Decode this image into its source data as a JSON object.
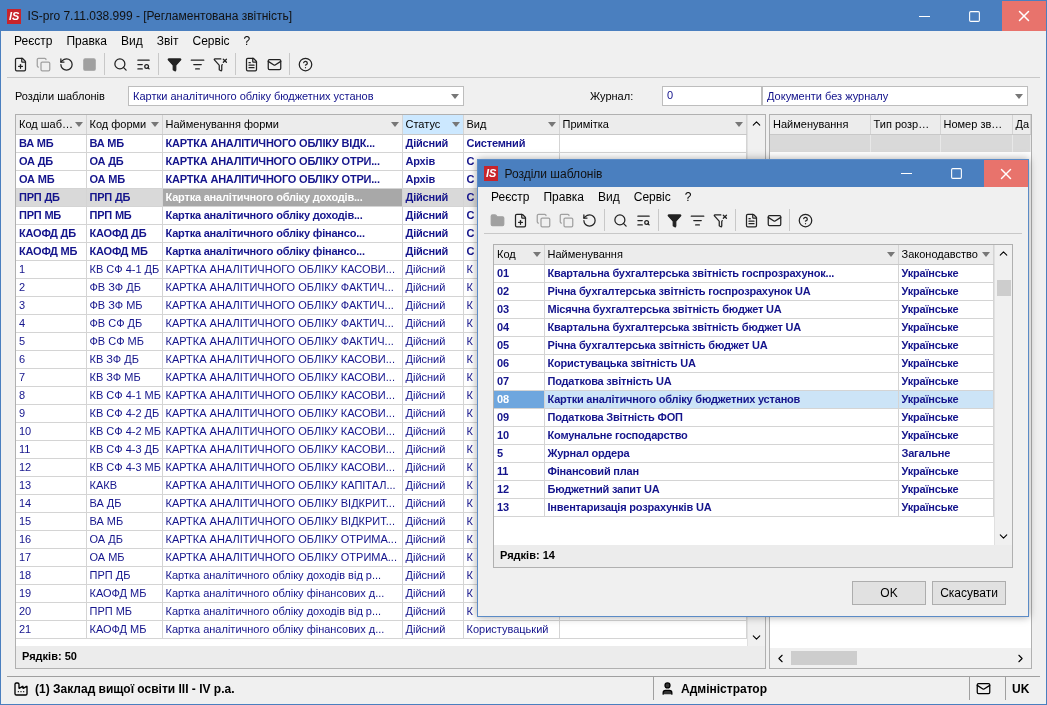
{
  "window": {
    "title": "IS-pro 7.11.038.999 - [Регламентована звітність]",
    "logo": "IS",
    "menu": [
      "Реєстр",
      "Правка",
      "Вид",
      "Звіт",
      "Сервіс",
      "?"
    ],
    "toolbar": [
      {
        "kind": "new",
        "disabled": false
      },
      {
        "kind": "copy",
        "disabled": true
      },
      {
        "kind": "refresh",
        "disabled": false
      },
      {
        "kind": "stop",
        "disabled": true
      },
      {
        "kind": "separator"
      },
      {
        "kind": "search",
        "disabled": false
      },
      {
        "kind": "find_next",
        "disabled": false
      },
      {
        "kind": "separator"
      },
      {
        "kind": "filter",
        "disabled": false
      },
      {
        "kind": "filter_sub",
        "disabled": false
      },
      {
        "kind": "filter_clear",
        "disabled": false
      },
      {
        "kind": "separator"
      },
      {
        "kind": "doc",
        "disabled": false
      },
      {
        "kind": "mail",
        "disabled": false
      },
      {
        "kind": "separator"
      },
      {
        "kind": "help",
        "disabled": false
      }
    ]
  },
  "filters": {
    "sections_label": "Розділи шаблонів",
    "sections_value": "Картки аналітичного обліку бюджетних установ",
    "journal_label": "Журнал:",
    "journal_value": "0",
    "journal_name": "Документи без журналу"
  },
  "forms_table": {
    "columns": [
      {
        "label": "Код шаб…",
        "sorted": false,
        "focused": false
      },
      {
        "label": "Код форми",
        "sorted": false,
        "focused": false
      },
      {
        "label": "Найменування форми",
        "sorted": false,
        "focused": true
      },
      {
        "label": "Статус",
        "sorted": true,
        "focused": false
      },
      {
        "label": "Вид",
        "sorted": false,
        "focused": false
      },
      {
        "label": "Примітка",
        "sorted": false
      }
    ],
    "rows": [
      {
        "cells": [
          "ВА МБ",
          "ВА МБ",
          "КАРТКА АНАЛІТИЧНОГО ОБЛІКУ ВІДК...",
          "Дійсний",
          "Системний",
          ""
        ],
        "bold": true,
        "selected": false
      },
      {
        "cells": [
          "ОА ДБ",
          "ОА ДБ",
          "КАРТКА АНАЛІТИЧНОГО ОБЛІКУ ОТРИ...",
          "Архів",
          "С",
          ""
        ],
        "bold": true,
        "selected": false
      },
      {
        "cells": [
          "ОА МБ",
          "ОА МБ",
          "КАРТКА АНАЛІТИЧНОГО ОБЛІКУ ОТРИ...",
          "Архів",
          "С",
          ""
        ],
        "bold": true,
        "selected": false
      },
      {
        "cells": [
          "ПРП ДБ",
          "ПРП ДБ",
          "Картка аналітичного обліку доходів...",
          "Дійсний",
          "С",
          ""
        ],
        "bold": true,
        "selected": true
      },
      {
        "cells": [
          "ПРП МБ",
          "ПРП МБ",
          "Картка аналітичного обліку доходів...",
          "Дійсний",
          "С",
          ""
        ],
        "bold": true,
        "selected": false
      },
      {
        "cells": [
          "КАОФД ДБ",
          "КАОФД ДБ",
          "Картка аналітичного обліку фінансо...",
          "Дійсний",
          "С",
          ""
        ],
        "bold": true,
        "selected": false
      },
      {
        "cells": [
          "КАОФД МБ",
          "КАОФД МБ",
          "Картка аналітичного обліку фінансо...",
          "Дійсний",
          "С",
          ""
        ],
        "bold": true,
        "selected": false
      },
      {
        "cells": [
          "1",
          "КВ СФ 4-1 ДБ",
          "КАРТКА АНАЛІТИЧНОГО ОБЛІКУ КАСОВИ...",
          "Дійсний",
          "К",
          ""
        ],
        "bold": false,
        "selected": false
      },
      {
        "cells": [
          "2",
          "ФВ ЗФ ДБ",
          "КАРТКА АНАЛІТИЧНОГО ОБЛІКУ ФАКТИЧ...",
          "Дійсний",
          "К",
          ""
        ],
        "bold": false,
        "selected": false
      },
      {
        "cells": [
          "3",
          "ФВ ЗФ МБ",
          "КАРТКА АНАЛІТИЧНОГО ОБЛІКУ ФАКТИЧ...",
          "Дійсний",
          "К",
          ""
        ],
        "bold": false,
        "selected": false
      },
      {
        "cells": [
          "4",
          "ФВ СФ ДБ",
          "КАРТКА АНАЛІТИЧНОГО ОБЛІКУ ФАКТИЧ...",
          "Дійсний",
          "К",
          ""
        ],
        "bold": false,
        "selected": false
      },
      {
        "cells": [
          "5",
          "ФВ СФ МБ",
          "КАРТКА АНАЛІТИЧНОГО ОБЛІКУ ФАКТИЧ...",
          "Дійсний",
          "К",
          ""
        ],
        "bold": false,
        "selected": false
      },
      {
        "cells": [
          "6",
          "КВ ЗФ ДБ",
          "КАРТКА АНАЛІТИЧНОГО ОБЛІКУ КАСОВИ...",
          "Дійсний",
          "К",
          ""
        ],
        "bold": false,
        "selected": false
      },
      {
        "cells": [
          "7",
          "КВ ЗФ МБ",
          "КАРТКА АНАЛІТИЧНОГО ОБЛІКУ КАСОВИ...",
          "Дійсний",
          "К",
          ""
        ],
        "bold": false,
        "selected": false
      },
      {
        "cells": [
          "8",
          "КВ СФ 4-1 МБ",
          "КАРТКА АНАЛІТИЧНОГО ОБЛІКУ КАСОВИ...",
          "Дійсний",
          "К",
          ""
        ],
        "bold": false,
        "selected": false
      },
      {
        "cells": [
          "9",
          "КВ СФ 4-2 ДБ",
          "КАРТКА АНАЛІТИЧНОГО ОБЛІКУ КАСОВИ...",
          "Дійсний",
          "К",
          ""
        ],
        "bold": false,
        "selected": false
      },
      {
        "cells": [
          "10",
          "КВ СФ 4-2 МБ",
          "КАРТКА АНАЛІТИЧНОГО ОБЛІКУ КАСОВИ...",
          "Дійсний",
          "К",
          ""
        ],
        "bold": false,
        "selected": false
      },
      {
        "cells": [
          "11",
          "КВ СФ 4-3 ДБ",
          "КАРТКА АНАЛІТИЧНОГО ОБЛІКУ КАСОВИ...",
          "Дійсний",
          "К",
          ""
        ],
        "bold": false,
        "selected": false
      },
      {
        "cells": [
          "12",
          "КВ СФ 4-3 МБ",
          "КАРТКА АНАЛІТИЧНОГО ОБЛІКУ КАСОВИ...",
          "Дійсний",
          "К",
          ""
        ],
        "bold": false,
        "selected": false
      },
      {
        "cells": [
          "13",
          "КАКВ",
          "КАРТКА АНАЛІТИЧНОГО ОБЛІКУ КАПІТАЛ...",
          "Дійсний",
          "К",
          ""
        ],
        "bold": false,
        "selected": false
      },
      {
        "cells": [
          "14",
          "ВА ДБ",
          "КАРТКА АНАЛІТИЧНОГО ОБЛІКУ ВІДКРИТ...",
          "Дійсний",
          "К",
          ""
        ],
        "bold": false,
        "selected": false
      },
      {
        "cells": [
          "15",
          "ВА МБ",
          "КАРТКА АНАЛІТИЧНОГО ОБЛІКУ ВІДКРИТ...",
          "Дійсний",
          "К",
          ""
        ],
        "bold": false,
        "selected": false
      },
      {
        "cells": [
          "16",
          "ОА ДБ",
          "КАРТКА АНАЛІТИЧНОГО ОБЛІКУ ОТРИМА...",
          "Дійсний",
          "К",
          ""
        ],
        "bold": false,
        "selected": false
      },
      {
        "cells": [
          "17",
          "ОА МБ",
          "КАРТКА АНАЛІТИЧНОГО ОБЛІКУ ОТРИМА...",
          "Дійсний",
          "К",
          ""
        ],
        "bold": false,
        "selected": false
      },
      {
        "cells": [
          "18",
          "ПРП ДБ",
          "Картка аналітичного обліку доходів від р...",
          "Дійсний",
          "К",
          ""
        ],
        "bold": false,
        "selected": false
      },
      {
        "cells": [
          "19",
          "КАОФД МБ",
          "Картка аналітичного обліку фінансових д...",
          "Дійсний",
          "К",
          ""
        ],
        "bold": false,
        "selected": false
      },
      {
        "cells": [
          "20",
          "ПРП МБ",
          "Картка аналітичного обліку доходів від р...",
          "Дійсний",
          "К",
          ""
        ],
        "bold": false,
        "selected": false
      },
      {
        "cells": [
          "21",
          "КАОФД МБ",
          "Картка аналітичного обліку фінансових д...",
          "Дійсний",
          "Користувацький",
          ""
        ],
        "bold": false,
        "selected": false
      }
    ],
    "footer": "Рядків: 50"
  },
  "details_table": {
    "columns": [
      "Найменування",
      "Тип розр…",
      "Номер зв…",
      "Да"
    ]
  },
  "status_bar": {
    "organization": "(1) Заклад вищої освіти III - IV р.а.",
    "user": "Адміністратор",
    "language": "UK"
  },
  "dialog": {
    "title": "Розділи шаблонів",
    "logo": "IS",
    "menu": [
      "Реєстр",
      "Правка",
      "Вид",
      "Сервіс",
      "?"
    ],
    "toolbar": [
      {
        "kind": "folder",
        "disabled": true
      },
      {
        "kind": "new",
        "disabled": false
      },
      {
        "kind": "copy",
        "disabled": true
      },
      {
        "kind": "copy",
        "disabled": true
      },
      {
        "kind": "refresh",
        "disabled": false
      },
      {
        "kind": "separator"
      },
      {
        "kind": "search",
        "disabled": false
      },
      {
        "kind": "find_next",
        "disabled": false
      },
      {
        "kind": "separator"
      },
      {
        "kind": "filter",
        "disabled": false
      },
      {
        "kind": "filter_sub",
        "disabled": false
      },
      {
        "kind": "filter_clear",
        "disabled": false
      },
      {
        "kind": "separator"
      },
      {
        "kind": "doc",
        "disabled": false
      },
      {
        "kind": "mail",
        "disabled": false
      },
      {
        "kind": "separator"
      },
      {
        "kind": "help",
        "disabled": false
      }
    ],
    "table": {
      "columns": [
        {
          "label": "Код",
          "sorted": false,
          "focused": true
        },
        {
          "label": "Найменування",
          "sorted": false,
          "focused": false
        },
        {
          "label": "Законодавство",
          "sorted": false,
          "focused": false
        }
      ],
      "rows": [
        {
          "cells": [
            "01",
            "Квартальна бухгалтерська звітність госпрозрахунок...",
            "Українське"
          ],
          "bold": true,
          "selected": false
        },
        {
          "cells": [
            "02",
            "Річна бухгалтерська звітність госпрозрахунок UA",
            "Українське"
          ],
          "bold": true,
          "selected": false
        },
        {
          "cells": [
            "03",
            "Місячна бухгалтерська звітність бюджет UA",
            "Українське"
          ],
          "bold": true,
          "selected": false
        },
        {
          "cells": [
            "04",
            "Квартальна бухгалтерська звітність бюджет UA",
            "Українське"
          ],
          "bold": true,
          "selected": false
        },
        {
          "cells": [
            "05",
            "Річна бухгалтерська звітність бюджет UA",
            "Українське"
          ],
          "bold": true,
          "selected": false
        },
        {
          "cells": [
            "06",
            "Користувацька звітність UA",
            "Українське"
          ],
          "bold": true,
          "selected": false
        },
        {
          "cells": [
            "07",
            "Податкова звітність UA",
            "Українське"
          ],
          "bold": true,
          "selected": false
        },
        {
          "cells": [
            "08",
            "Картки аналітичного обліку бюджетних установ",
            "Українське"
          ],
          "bold": true,
          "selected": true
        },
        {
          "cells": [
            "09",
            "Податкова Звітність ФОП",
            "Українське"
          ],
          "bold": true,
          "selected": false
        },
        {
          "cells": [
            "10",
            "Комунальне господарство",
            "Українське"
          ],
          "bold": true,
          "selected": false
        },
        {
          "cells": [
            "5",
            "Журнал ордера",
            "Загальне"
          ],
          "bold": true,
          "selected": false
        },
        {
          "cells": [
            "11",
            "Фінансовий план",
            "Українське"
          ],
          "bold": true,
          "selected": false
        },
        {
          "cells": [
            "12",
            "Бюджетний запит UA",
            "Українське"
          ],
          "bold": true,
          "selected": false
        },
        {
          "cells": [
            "13",
            "Інвентаризація розрахунків UA",
            "Українське"
          ],
          "bold": true,
          "selected": false
        }
      ],
      "footer": "Рядків: 14"
    },
    "buttons": [
      "OK",
      "Скасувати"
    ]
  }
}
